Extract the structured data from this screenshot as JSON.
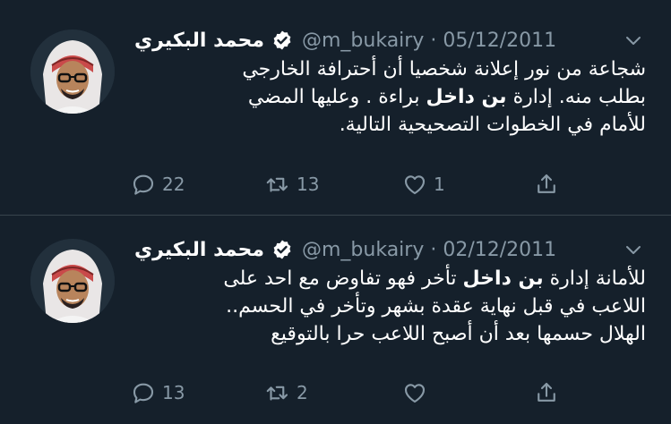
{
  "tweets": [
    {
      "name": "محمد البكيري",
      "handle": "@m_bukairy",
      "date": "05/12/2011",
      "dot": "·",
      "lines": [
        "شجاعة من نور إعلانة شخصيا أن أحترافة الخارجي",
        {
          "before": "بطلب منه. إدارة ",
          "tag": "بن داخل",
          "after": " براءة .  وعليها المضي"
        },
        "للأمام في الخطوات التصحيحية التالية."
      ],
      "replies": "22",
      "retweets": "13",
      "likes": "1"
    },
    {
      "name": "محمد البكيري",
      "handle": "@m_bukairy",
      "date": "02/12/2011",
      "dot": "·",
      "lines": [
        {
          "before": "للأمانة إدارة ",
          "tag": "بن داخل",
          "after": " تأخر فهو تفاوض مع احد على"
        },
        "اللاعب في قبل نهاية عقدة بشهر وتأخر في الحسم..",
        "الهلال حسمها بعد أن أصبح اللاعب حرا بالتوقيع"
      ],
      "replies": "13",
      "retweets": "2",
      "likes": ""
    }
  ],
  "colors": {
    "background": "#15202b",
    "text": "#ffffff",
    "muted": "#8899a6",
    "divider": "#38444d"
  },
  "icons": [
    "verified-badge-icon",
    "chevron-down-icon",
    "reply-icon",
    "retweet-icon",
    "like-icon",
    "share-icon"
  ]
}
